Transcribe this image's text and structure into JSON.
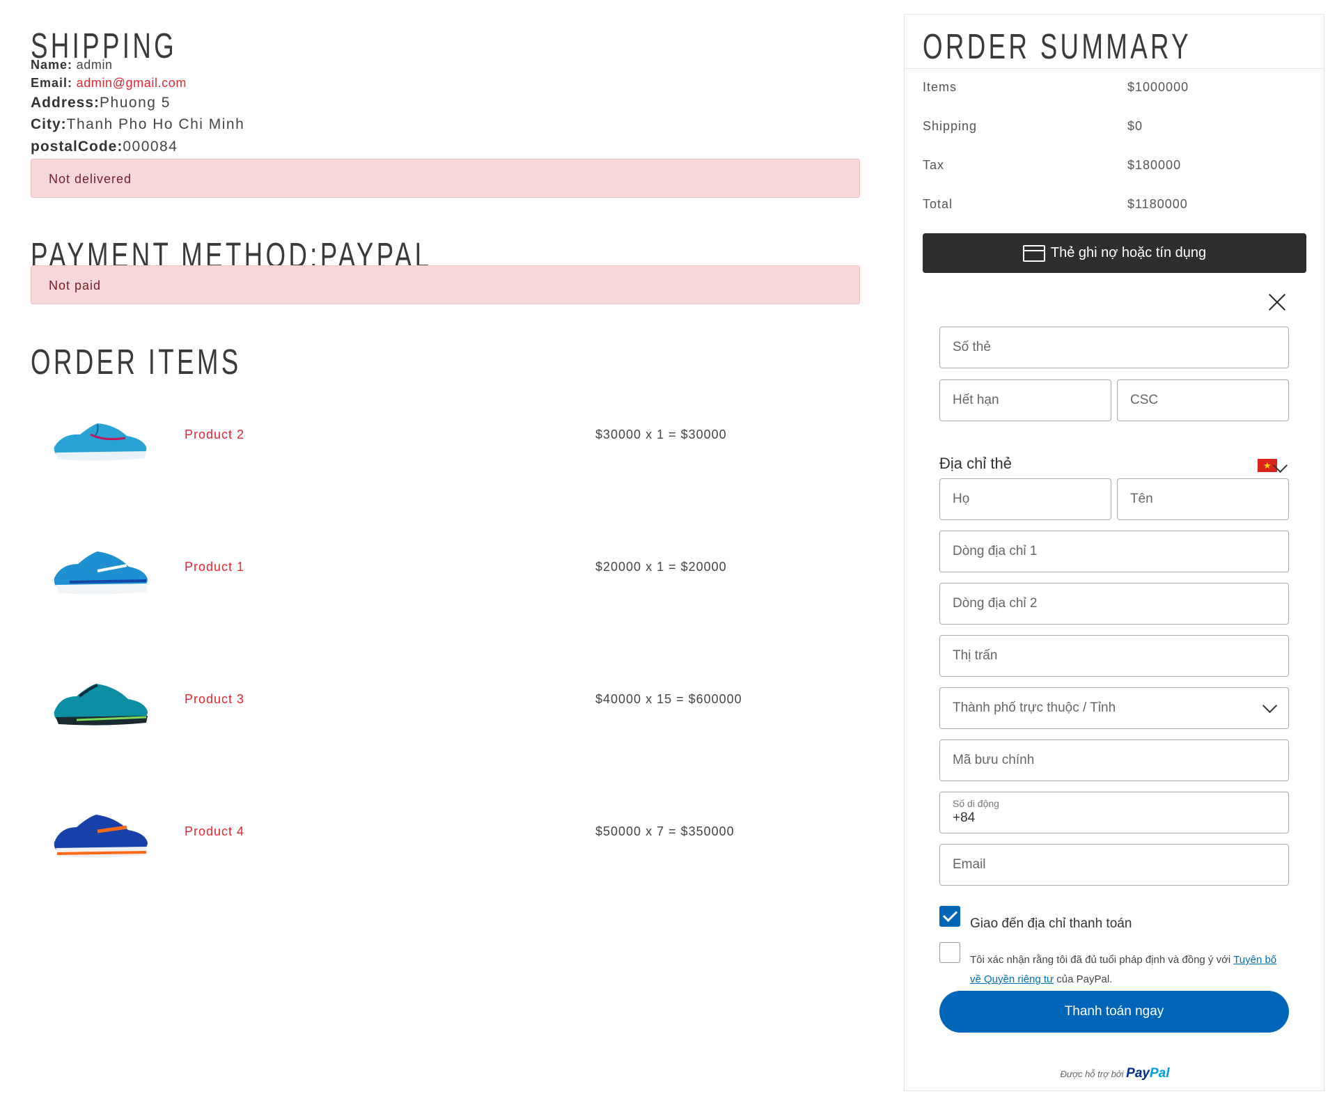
{
  "shipping": {
    "title": "Shipping",
    "name_label": "Name:",
    "name": "admin",
    "email_label": "Email:",
    "email": "admin@gmail.com",
    "address_label": "Address:",
    "address": "Phuong 5",
    "city_label": "City:",
    "city": "Thanh Pho Ho Chi Minh",
    "postal_label": "postalCode:",
    "postal": "000084",
    "status": "Not delivered"
  },
  "payment": {
    "title": "Payment Method:PayPal",
    "status": "Not paid"
  },
  "order_items": {
    "title": "Order Items",
    "items": [
      {
        "name": "Product 2",
        "price": "$30000 x 1 = $30000",
        "image": "blue-running-shoe"
      },
      {
        "name": "Product 1",
        "price": "$20000 x 1 = $20000",
        "image": "blue-running-shoe"
      },
      {
        "name": "Product 3",
        "price": "$40000 x 15 = $600000",
        "image": "teal-running-shoe"
      },
      {
        "name": "Product 4",
        "price": "$50000 x 7 = $350000",
        "image": "navy-orange-running-shoe"
      }
    ]
  },
  "summary": {
    "title": "Order Summary",
    "rows": [
      {
        "label": "Items",
        "value": "$1000000"
      },
      {
        "label": "Shipping",
        "value": "$0"
      },
      {
        "label": "Tax",
        "value": "$180000"
      },
      {
        "label": "Total",
        "value": "$1180000"
      }
    ]
  },
  "paypal": {
    "card_button": "Thẻ ghi nợ hoặc tín dụng",
    "card_number": "Số thẻ",
    "expiry": "Hết hạn",
    "csc": "CSC",
    "billing_title": "Địa chỉ thẻ",
    "last_name": "Họ",
    "first_name": "Tên",
    "address1": "Dòng địa chỉ 1",
    "address2": "Dòng địa chỉ 2",
    "town": "Thị trấn",
    "province": "Thành phố trực thuộc / Tỉnh",
    "postal": "Mã bưu chính",
    "phone_label": "Số di động",
    "phone_value": "+84",
    "email": "Email",
    "ship_to_billing": "Giao đến địa chỉ thanh toán",
    "consent_pre": "Tôi xác nhận rằng tôi đã đủ tuổi pháp định và đồng ý với ",
    "consent_link": "Tuyên bố về Quyền riêng tư",
    "consent_post": " của PayPal.",
    "pay_button": "Thanh toán ngay",
    "powered_by": "Được hỗ trợ bởi",
    "brand_pay": "Pay",
    "brand_pal": "Pal"
  },
  "colors": {
    "accent_red": "#e3262f",
    "alert_bg": "#f8d7da",
    "paypal_blue": "#0065b7",
    "dark_button": "#2c2e2f"
  }
}
